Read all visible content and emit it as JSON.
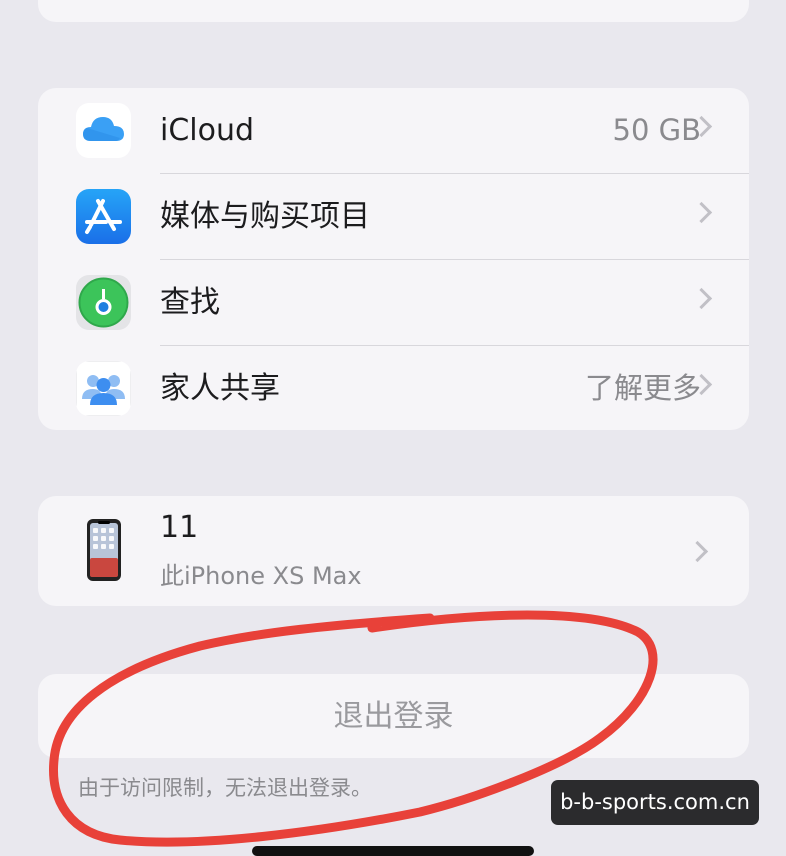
{
  "services": {
    "items": [
      {
        "label": "iCloud",
        "value": "50 GB",
        "icon": "icloud-icon"
      },
      {
        "label": "媒体与购买项目",
        "value": "",
        "icon": "app-store-icon"
      },
      {
        "label": "查找",
        "value": "",
        "icon": "find-my-icon"
      },
      {
        "label": "家人共享",
        "value": "了解更多",
        "icon": "family-sharing-icon"
      }
    ]
  },
  "device": {
    "name": "11",
    "model": "此iPhone XS Max",
    "icon": "iphone-icon"
  },
  "signout": {
    "label": "退出登录",
    "note": "由于访问限制，无法退出登录。"
  },
  "watermark": "b-b-sports.com.cn",
  "colors": {
    "background": "#e9e8ee",
    "card": "#f6f5f8",
    "annotation": "#e8382e",
    "app_store_blue": "#1f7cf2",
    "find_my_green": "#3cc45a"
  }
}
